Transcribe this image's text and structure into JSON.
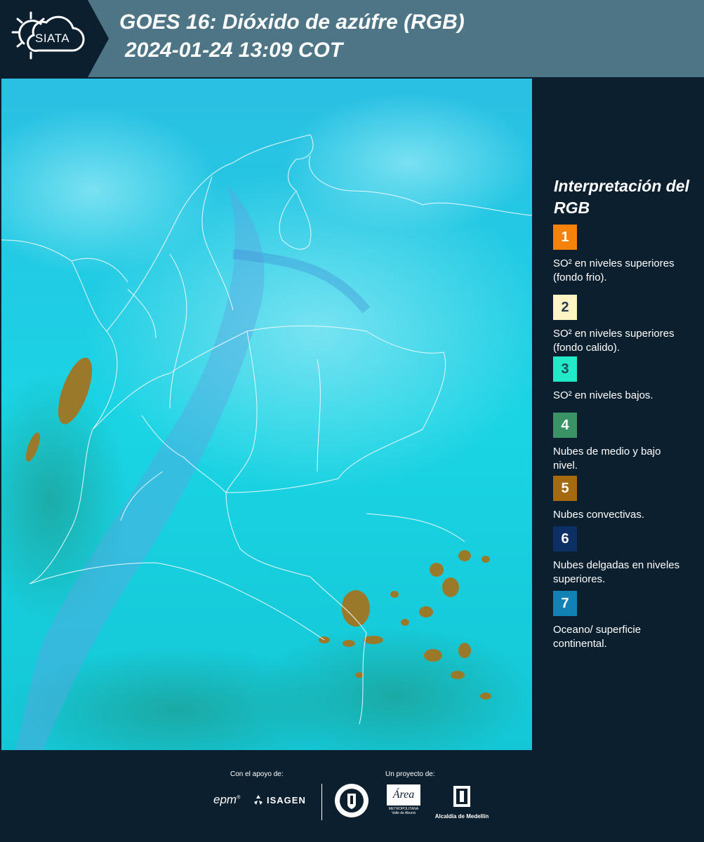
{
  "header": {
    "logo_text": "SIATA",
    "title_line1": "GOES 16: Dióxido de azúfre (RGB)",
    "title_line2": "2024-01-24 13:09 COT",
    "bg_color": "#4d7585"
  },
  "legend": {
    "title": "Interpretación del RGB",
    "items": [
      {
        "number": "1",
        "color": "#f5820a",
        "text_color": "#ffffff",
        "description": "SO² en niveles superiores (fondo frio)."
      },
      {
        "number": "2",
        "color": "#fdf3c3",
        "text_color": "#2a3a55",
        "description": "SO² en niveles superiores (fondo calido)."
      },
      {
        "number": "3",
        "color": "#22eac8",
        "text_color": "#1c4a56",
        "description": "SO² en niveles bajos."
      },
      {
        "number": "4",
        "color": "#3a9364",
        "text_color": "#ffffff",
        "description": "Nubes de medio y bajo nivel."
      },
      {
        "number": "5",
        "color": "#a56a10",
        "text_color": "#ffffff",
        "description": "Nubes convectivas."
      },
      {
        "number": "6",
        "color": "#0c2f64",
        "text_color": "#ffffff",
        "description": "Nubes delgadas en niveles superiores."
      },
      {
        "number": "7",
        "color": "#1282b4",
        "text_color": "#ffffff",
        "description": "Oceano/ superficie continental."
      }
    ]
  },
  "footer": {
    "support_label": "Con el apoyo de:",
    "project_label": "Un proyecto de:",
    "sponsor_epm": "epm",
    "sponsor_isagen": "ISAGEN",
    "partner_area": "Área",
    "partner_area_sub": "METROPOLITANA",
    "partner_area_sub2": "Valle de Aburrá",
    "partner_alcaldia": "Alcaldía de Medellín",
    "partner_medellin_seal": "MEDELLÍN"
  }
}
